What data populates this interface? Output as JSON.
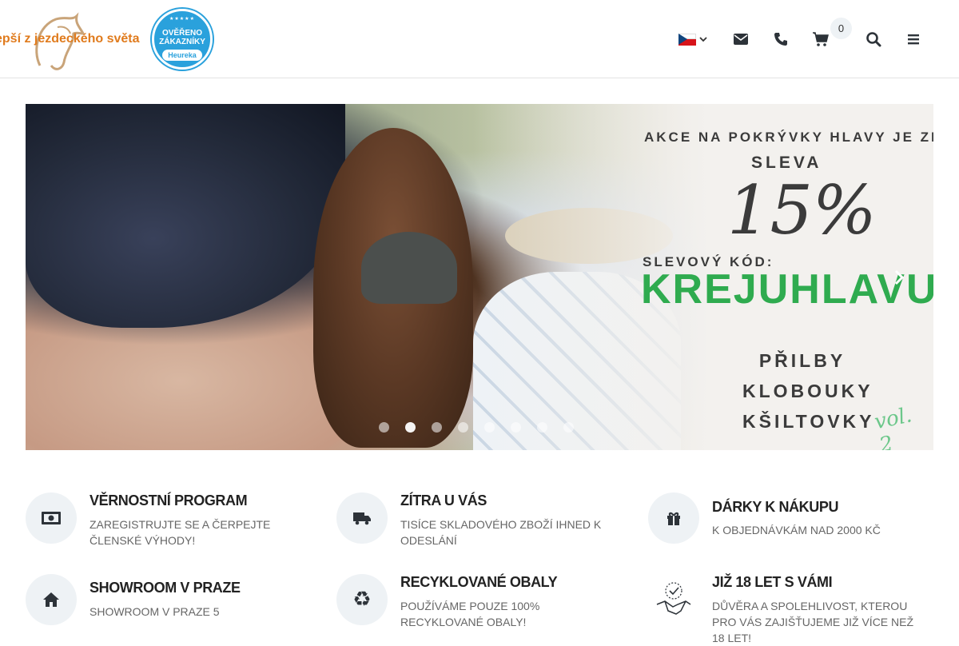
{
  "header": {
    "slogan": "epší z jezdeckého světa",
    "heureka": {
      "line1": "OVĚŘENO",
      "line2": "ZÁKAZNÍKY",
      "brand": "Heureka"
    },
    "cart_count": "0",
    "icons": [
      "czech-flag-icon",
      "chevron-down-icon",
      "envelope-icon",
      "phone-icon",
      "cart-icon",
      "search-icon",
      "menu-icon"
    ]
  },
  "banner": {
    "headline": "AKCE NA POKRÝVKY HLAVY JE ZPĚT!",
    "sleva": "SLEVA",
    "percent": "15%",
    "code_label": "SLEVOVÝ KÓD:",
    "code": "KREJUHLAVU",
    "items": [
      "PŘILBY",
      "KLOBOUKY",
      "KŠILTOVKY"
    ],
    "vol": "vol. 2",
    "slide_count": 8,
    "active_slide": 1
  },
  "features": [
    {
      "title": "VĚRNOSTNÍ PROGRAM",
      "text": "ZAREGISTRUJTE SE A ČERPEJTE ČLENSKÉ VÝHODY!",
      "icon": "money-icon"
    },
    {
      "title": "ZÍTRA U VÁS",
      "text": "TISÍCE SKLADOVÉHO ZBOŽÍ IHNED K ODESLÁNÍ",
      "icon": "truck-icon"
    },
    {
      "title": "DÁRKY K NÁKUPU",
      "text": "K OBJEDNÁVKÁM NAD 2000 KČ",
      "icon": "gift-icon"
    },
    {
      "title": "SHOWROOM V PRAZE",
      "text": "SHOWROOM V PRAZE 5",
      "icon": "home-icon"
    },
    {
      "title": "RECYKLOVANÉ OBALY",
      "text": "POUŽÍVÁME POUZE 100% RECYKLOVANÉ OBALY!",
      "icon": "recycle-icon"
    },
    {
      "title": "JIŽ 18 LET S VÁMI",
      "text": "DŮVĚRA A SPOLEHLIVOST, KTEROU PRO VÁS ZAJIŠŤUJEME JIŽ VÍCE NEŽ 18 LET!",
      "icon": "handshake-icon"
    }
  ],
  "colors": {
    "accent": "#e07b1d",
    "promo_green": "#2fab4f",
    "heureka_blue": "#2aa1dc"
  }
}
